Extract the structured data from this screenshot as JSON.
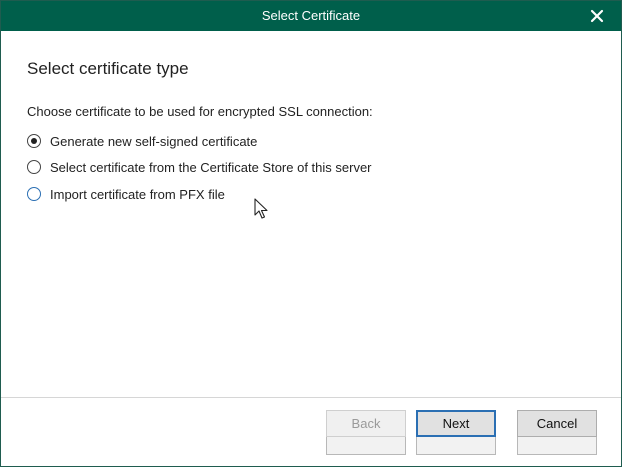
{
  "window": {
    "title": "Select Certificate"
  },
  "content": {
    "heading": "Select certificate type",
    "instruction": "Choose certificate to be used for encrypted SSL connection:",
    "options": [
      {
        "label": "Generate new self-signed certificate",
        "checked": true
      },
      {
        "label": "Select certificate from the Certificate Store of this server",
        "checked": false
      },
      {
        "label": "Import certificate from PFX file",
        "checked": false
      }
    ]
  },
  "buttons": {
    "back": "Back",
    "next": "Next",
    "cancel": "Cancel"
  },
  "colors": {
    "titlebar": "#005f4b",
    "focus": "#2b6fb3"
  },
  "icons": {
    "close": "close-icon",
    "cursor": "mouse-pointer-icon"
  }
}
